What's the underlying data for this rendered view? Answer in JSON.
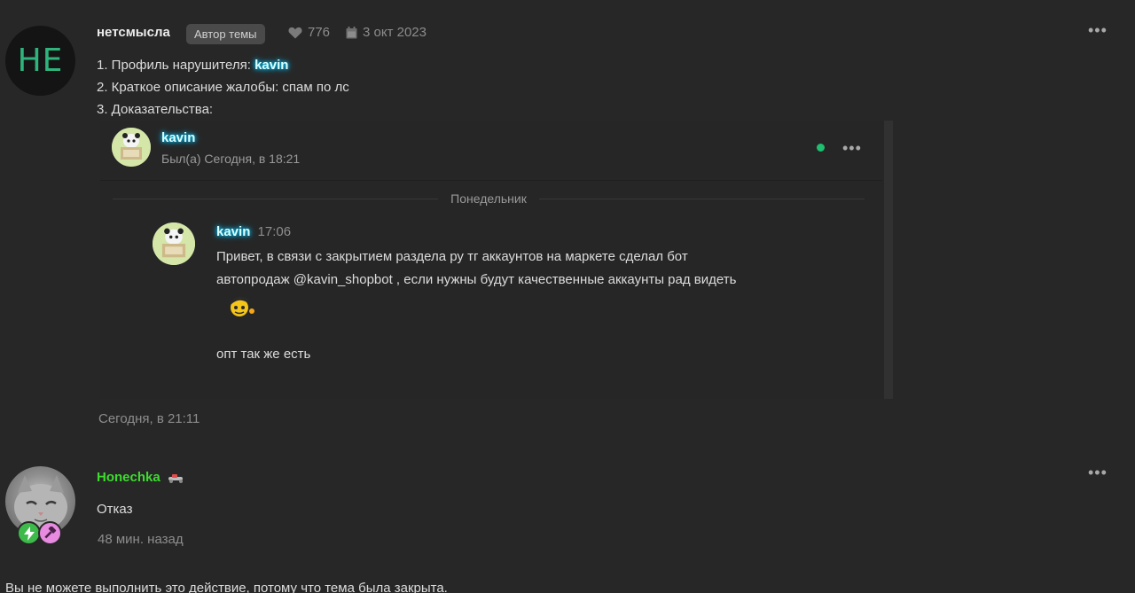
{
  "post1": {
    "avatar_initials": "НЕ",
    "username": "нетсмысла",
    "author_badge": "Автор темы",
    "likes": "776",
    "date": "3 окт 2023",
    "lines": {
      "l1_prefix": "1. Профиль нарушителя: ",
      "l1_name": "kavin",
      "l2": "2. Краткое описание жалобы: спам по лс",
      "l3": "3. Доказательства:"
    },
    "screenshot": {
      "contact_name": "kavin",
      "last_seen": "Был(а) Сегодня, в 18:21",
      "day_separator": "Понедельник",
      "message": {
        "sender": "kavin",
        "time": "17:06",
        "text_line1": "Привет, в связи с закрытием раздела ру тг аккаунтов на маркете сделал бот",
        "text_line2": "автопродаж @kavin_shopbot , если нужны будут качественные аккаунты рад видеть",
        "text_line3": "опт так же есть"
      }
    },
    "timestamp": "Сегодня, в 21:11"
  },
  "post2": {
    "username": "Honechka",
    "text": "Отказ",
    "timestamp": "48 мин. назад"
  },
  "notice": "Вы не можете выполнить это действие, потому что тема была закрыта.",
  "colors": {
    "background": "#272727",
    "accent_green": "#2fb47d",
    "name_green": "#3ddc2f",
    "glow_cyan": "#00cfff",
    "online": "#1fbf6f"
  },
  "icons": [
    "heart-icon",
    "calendar-icon",
    "more-icon",
    "emoji-icon",
    "lightning-icon",
    "hammer-icon",
    "rider-icon"
  ]
}
